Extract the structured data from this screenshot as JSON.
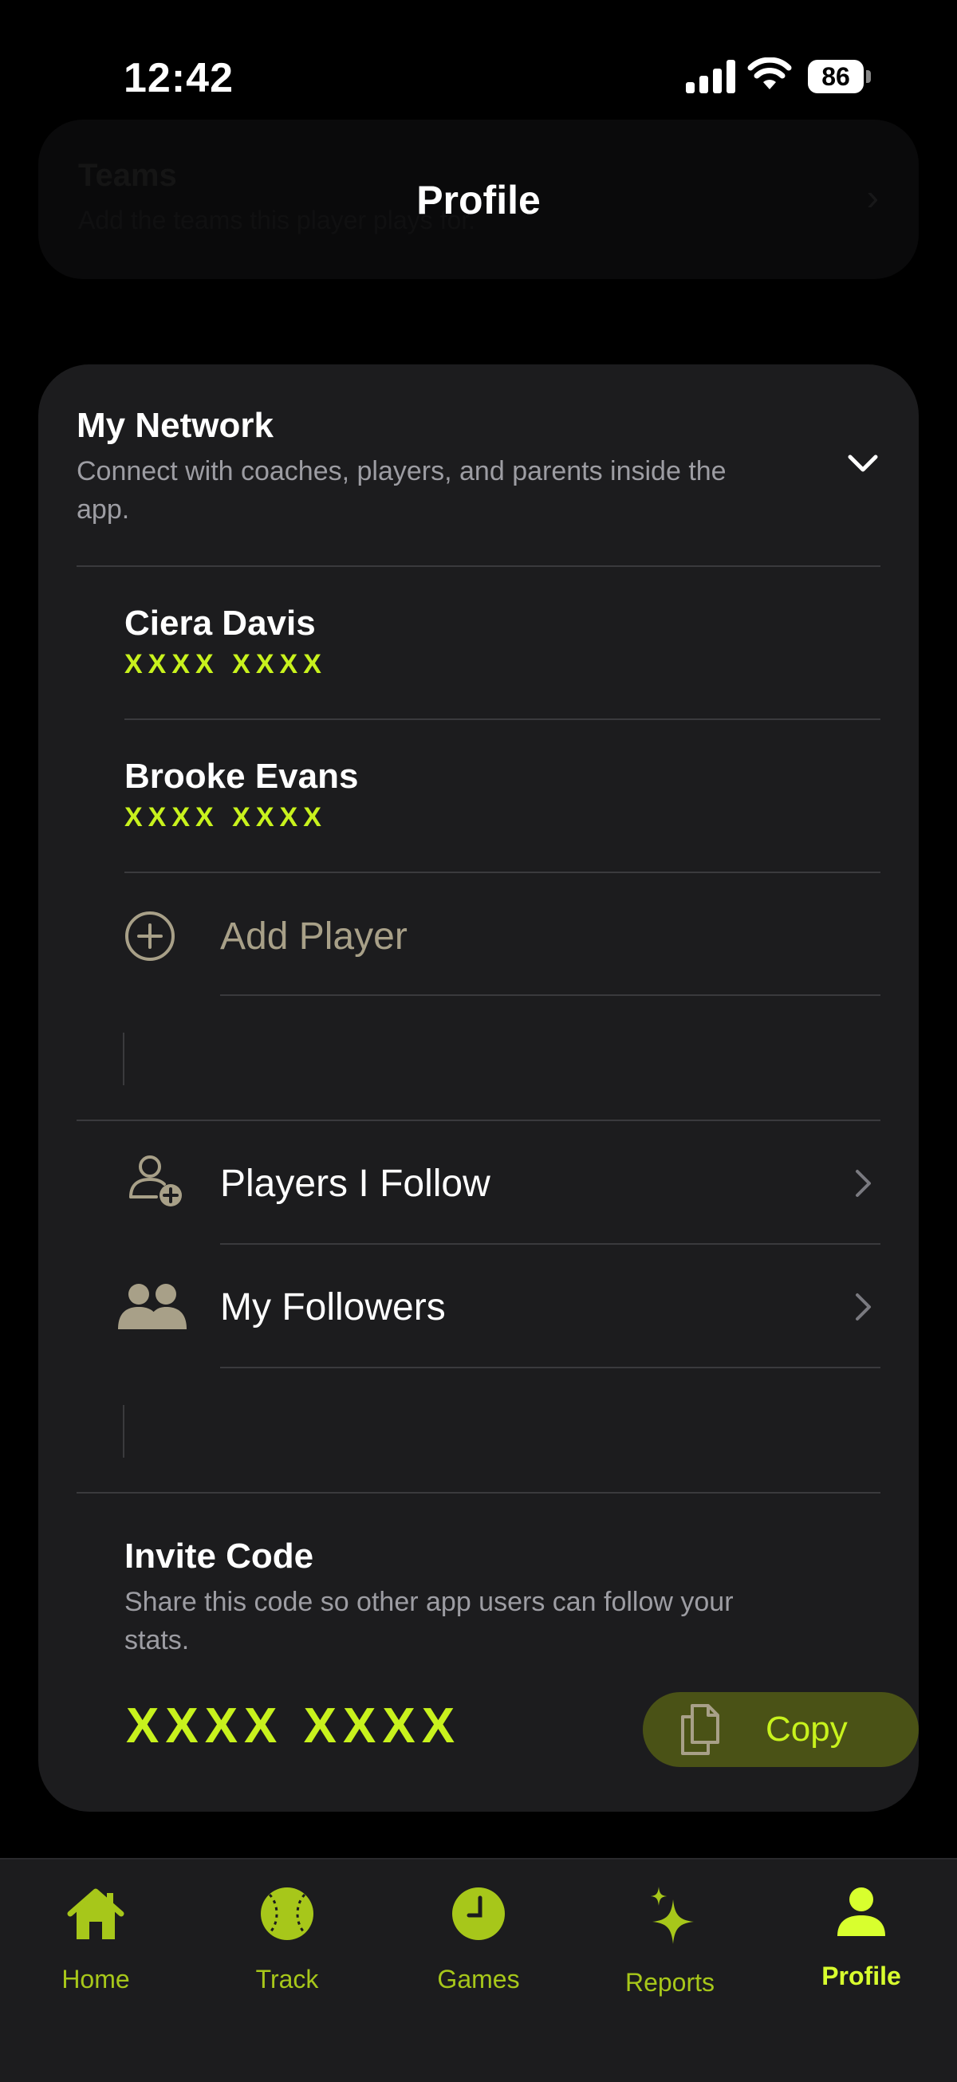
{
  "status_bar": {
    "time": "12:42",
    "battery": "86"
  },
  "ghost_card": {
    "title": "Teams",
    "subtitle": "Add the teams this player plays for."
  },
  "header": {
    "title": "Profile"
  },
  "network": {
    "title": "My Network",
    "description": "Connect with coaches, players, and parents inside the app.",
    "players": [
      {
        "name": "Ciera Davis",
        "code": "XXXX XXXX"
      },
      {
        "name": "Brooke Evans",
        "code": "XXXX XXXX"
      }
    ],
    "add_player_label": "Add Player",
    "players_i_follow_label": "Players I Follow",
    "my_followers_label": "My Followers"
  },
  "invite": {
    "title": "Invite Code",
    "description": "Share this code so other app users can follow your stats.",
    "code": "XXXX XXXX",
    "copy_label": "Copy"
  },
  "tabs": [
    {
      "label": "Home",
      "icon": "home-icon"
    },
    {
      "label": "Track",
      "icon": "softball-icon"
    },
    {
      "label": "Games",
      "icon": "clock-icon"
    },
    {
      "label": "Reports",
      "icon": "sparkle-icon"
    },
    {
      "label": "Profile",
      "icon": "person-icon",
      "active": true
    }
  ],
  "colors": {
    "accent": "#c8f21d",
    "card": "#1c1c1e",
    "muted": "#9d9da3",
    "icon_tan": "#a8a088"
  }
}
